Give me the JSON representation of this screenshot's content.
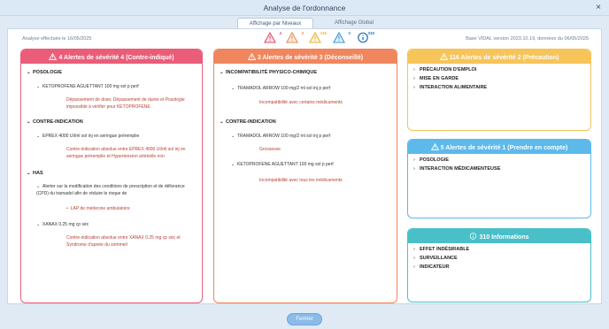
{
  "window": {
    "title": "Analyse de l'ordonnance",
    "close_icon": "×"
  },
  "tabs": [
    {
      "label": "Affichage par Niveaux",
      "active": true
    },
    {
      "label": "Affichage Global",
      "active": false
    }
  ],
  "meta": {
    "analysis_date": "Analyse effectuée le 16/05/2025",
    "base": "Base VIDAL version 2023.10.19, données du 06/05/2025"
  },
  "summary": [
    {
      "icon": "warning-icon-red",
      "count": "4",
      "color": "#e24f6a"
    },
    {
      "icon": "warning-icon-orange",
      "count": "3",
      "color": "#ee8a54"
    },
    {
      "icon": "warning-icon-yellow",
      "count": "116",
      "color": "#e9b632"
    },
    {
      "icon": "warning-icon-blue",
      "count": "5",
      "color": "#3c95de"
    },
    {
      "icon": "info-icon",
      "count": "310",
      "color": "#1f6eb4"
    }
  ],
  "panel1": {
    "header": "4 Alertes de sévérité 4 (Contre-indiqué)",
    "color": "#ea5d79",
    "sections": [
      {
        "title": "POSOLOGIE"
      },
      {
        "title": "CONTRE-INDICATION"
      },
      {
        "title": "HAS"
      }
    ],
    "items": [
      {
        "drug": "KETOPROFENE AGUETTANT 100 mg sol p perf",
        "alert": "Dépassement de dose; Dépassement de durée et Posologie impossible à vérifier pour KETOPROFENE"
      },
      {
        "drug": "EPREX 4000 UI/ml sol inj en seringue préremplie",
        "alert": "Contre-indication absolue entre EPREX 4000 UI/ml sol inj en seringue préremplie et Hypertension artérielle non"
      },
      {
        "drug": "Alerter sur la modification des conditions de prescription et de délivrance (CPD) du tramadol afin de réduire le risque de",
        "lap": "LAP de médecine ambulatoire"
      },
      {
        "drug": "XANAX 0.25 mg cp séc",
        "alert": "Contre-indication absolue entre XANAX 0.25 mg cp séc et Syndrome d'apnée du sommeil"
      }
    ]
  },
  "panel2": {
    "header": "3 Alertes de sévérité 3 (Déconseillé)",
    "color": "#f0865d",
    "sections": [
      {
        "title": "INCOMPATIBILITÉ PHYSICO-CHIMIQUE"
      },
      {
        "title": "CONTRE-INDICATION"
      }
    ],
    "items": [
      {
        "drug": "TRAMADOL ARROW 100 mg/2 ml sol inj p perf",
        "alert": "Incompatibilité avec certains médicaments"
      },
      {
        "drug": "TRAMADOL ARROW 100 mg/2 ml sol inj p perf",
        "alert": "Grossesse"
      },
      {
        "drug": "KETOPROFENE AGUETTANT 100 mg sol p perf",
        "alert": "Incompatibilité avec tous les médicaments"
      }
    ]
  },
  "panel3": {
    "header": "116 Alertes de sévérité 2 (Précaution)",
    "color": "#f7c45a",
    "items": [
      "PRÉCAUTION D'EMPLOI",
      "MISE EN GARDE",
      "INTERACTION ALIMENTAIRE"
    ]
  },
  "panel4": {
    "header": "5 Alertes de sévérité 1 (Prendre en compte)",
    "color": "#5db9ea",
    "items": [
      "POSOLOGIE",
      "INTERACTION MÉDICAMENTEUSE"
    ]
  },
  "panel5": {
    "header": "310 Informations",
    "color": "#49bfc8",
    "items": [
      "EFFET INDÉSIRABLE",
      "SURVEILLANCE",
      "INDICATEUR"
    ]
  },
  "footer": {
    "close_label": "Fermer"
  }
}
